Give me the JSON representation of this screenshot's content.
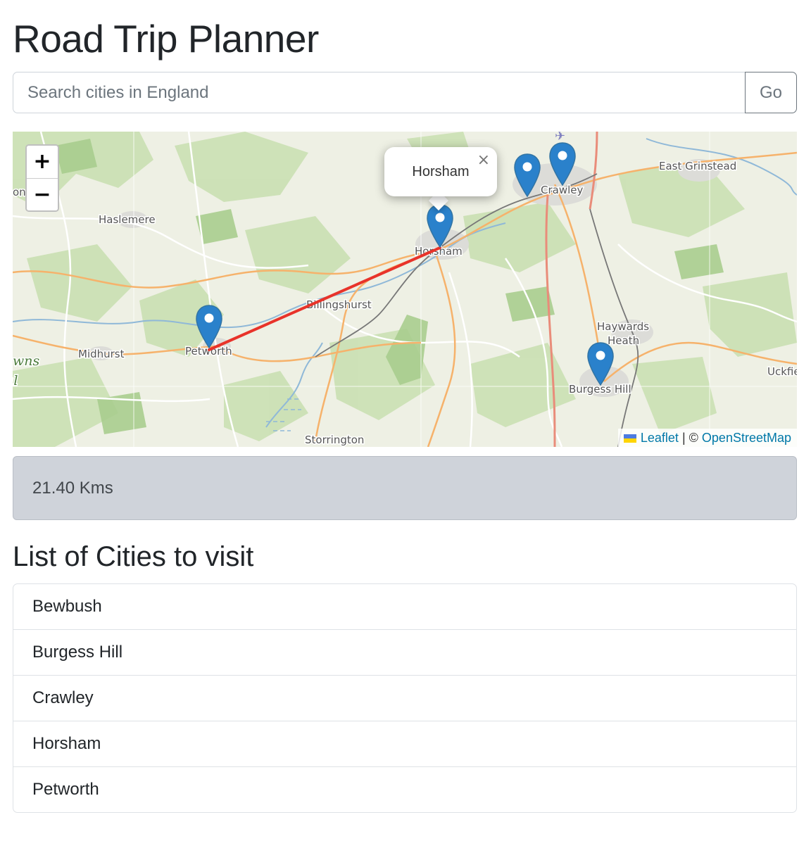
{
  "header": {
    "title": "Road Trip Planner"
  },
  "search": {
    "placeholder": "Search cities in England",
    "value": "",
    "button_label": "Go"
  },
  "map": {
    "zoom_in_label": "+",
    "zoom_out_label": "−",
    "popup": {
      "text": "Horsham",
      "close_label": "×"
    },
    "place_labels": [
      {
        "name": "Haslemere"
      },
      {
        "name": "Midhurst"
      },
      {
        "name": "Petworth"
      },
      {
        "name": "Billingshurst"
      },
      {
        "name": "Horsham"
      },
      {
        "name": "Crawley"
      },
      {
        "name": "East Grinstead"
      },
      {
        "name": "Haywards"
      },
      {
        "name": "Heath"
      },
      {
        "name": "Burgess Hill"
      },
      {
        "name": "Storrington"
      },
      {
        "name": "Uckfie"
      },
      {
        "name": "on"
      },
      {
        "name": "wns"
      },
      {
        "name": "al"
      }
    ],
    "markers": [
      "Crawley west",
      "Crawley",
      "Horsham",
      "Petworth",
      "Burgess Hill"
    ],
    "route": {
      "color": "#e8332a",
      "from": "Petworth",
      "to": "Horsham"
    },
    "attribution": {
      "leaflet": "Leaflet",
      "separator": "| ©",
      "osm": "OpenStreetMap"
    }
  },
  "distance": {
    "text": "21.40 Kms"
  },
  "cities": {
    "heading": "List of Cities to visit",
    "items": [
      "Bewbush",
      "Burgess Hill",
      "Crawley",
      "Horsham",
      "Petworth"
    ]
  },
  "colors": {
    "marker": "#2a81cb",
    "link": "#0078a8",
    "distance_bg": "#cfd3da"
  }
}
